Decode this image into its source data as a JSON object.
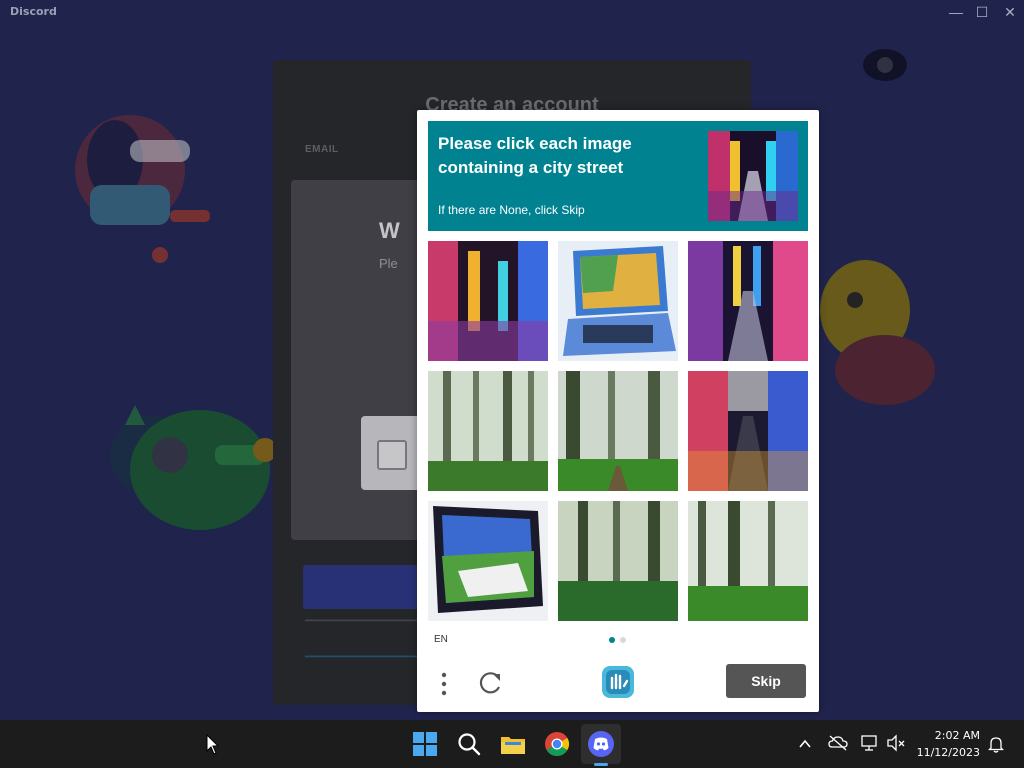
{
  "window": {
    "title": "Discord",
    "controls": {
      "minimize": "—",
      "maximize": "☐",
      "close": "✕"
    }
  },
  "background_page": {
    "heading": "Create an account",
    "email_label": "EMAIL",
    "panel_title": "W",
    "panel_subtitle": "Ple"
  },
  "captcha": {
    "prompt_main": "Please click each image containing a city street",
    "prompt_sub": "If there are None, click Skip",
    "tiles": [
      {
        "content": "city-street-neon"
      },
      {
        "content": "laptop"
      },
      {
        "content": "city-street-neon"
      },
      {
        "content": "forest"
      },
      {
        "content": "forest"
      },
      {
        "content": "city-street-neon"
      },
      {
        "content": "laptop"
      },
      {
        "content": "forest"
      },
      {
        "content": "forest"
      }
    ],
    "language": "EN",
    "skip_label": "Skip",
    "accent_color": "#008290"
  },
  "taskbar": {
    "apps": [
      "start-icon",
      "search-icon",
      "file-explorer-icon",
      "chrome-icon",
      "discord-icon"
    ],
    "time": "2:02 AM",
    "date": "11/12/2023"
  }
}
